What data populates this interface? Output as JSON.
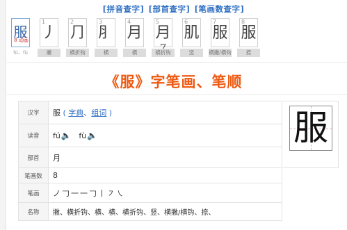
{
  "top_nav": {
    "pinyin_link": "[拼音查字]",
    "radical_link": "[部首查字]",
    "stroke_link": "[笔画数查字]"
  },
  "strokes_strip": {
    "character": {
      "glyph": "服",
      "count_label": "8 动画",
      "pinyin_label": "fú、fù"
    },
    "steps": [
      {
        "num": "1",
        "glyph": "丿",
        "name": "撇"
      },
      {
        "num": "2",
        "glyph": "⺆",
        "name": "横折钩"
      },
      {
        "num": "3",
        "glyph": "⺼",
        "name": "横"
      },
      {
        "num": "4",
        "glyph": "月",
        "name": "横"
      },
      {
        "num": "5",
        "glyph": "月⁷",
        "name": "横折钩"
      },
      {
        "num": "6",
        "glyph": "肌",
        "name": "竖"
      },
      {
        "num": "7",
        "glyph": "服",
        "name": "横撇/横钩"
      },
      {
        "num": "8",
        "glyph": "服",
        "name": "捺"
      }
    ]
  },
  "heading": "《服》字笔画、笔顺",
  "info": {
    "hanzi_label": "汉字",
    "hanzi_value": "服",
    "dict_link": "字典",
    "words_link": "组词",
    "reading_label": "读音",
    "reading_1": "fú",
    "reading_2": "fù",
    "radical_label": "部首",
    "radical_value": "月",
    "stroke_count_label": "笔画数",
    "stroke_count_value": "8",
    "strokes_label": "笔画",
    "strokes_value": "ノ𠃌一一𠃌丨㇇㇏",
    "names_label": "名称",
    "names_value": "撇、横折钩、横、横、横折钩、竖、横撇/横钩、捺、"
  },
  "big_char": "服",
  "colors": {
    "link": "#2f6fc2",
    "heading": "#ee5a12",
    "speaker": "#e7a100",
    "label_bg": "#f5f5f5"
  },
  "icons": {
    "speaker": "speaker-icon"
  }
}
